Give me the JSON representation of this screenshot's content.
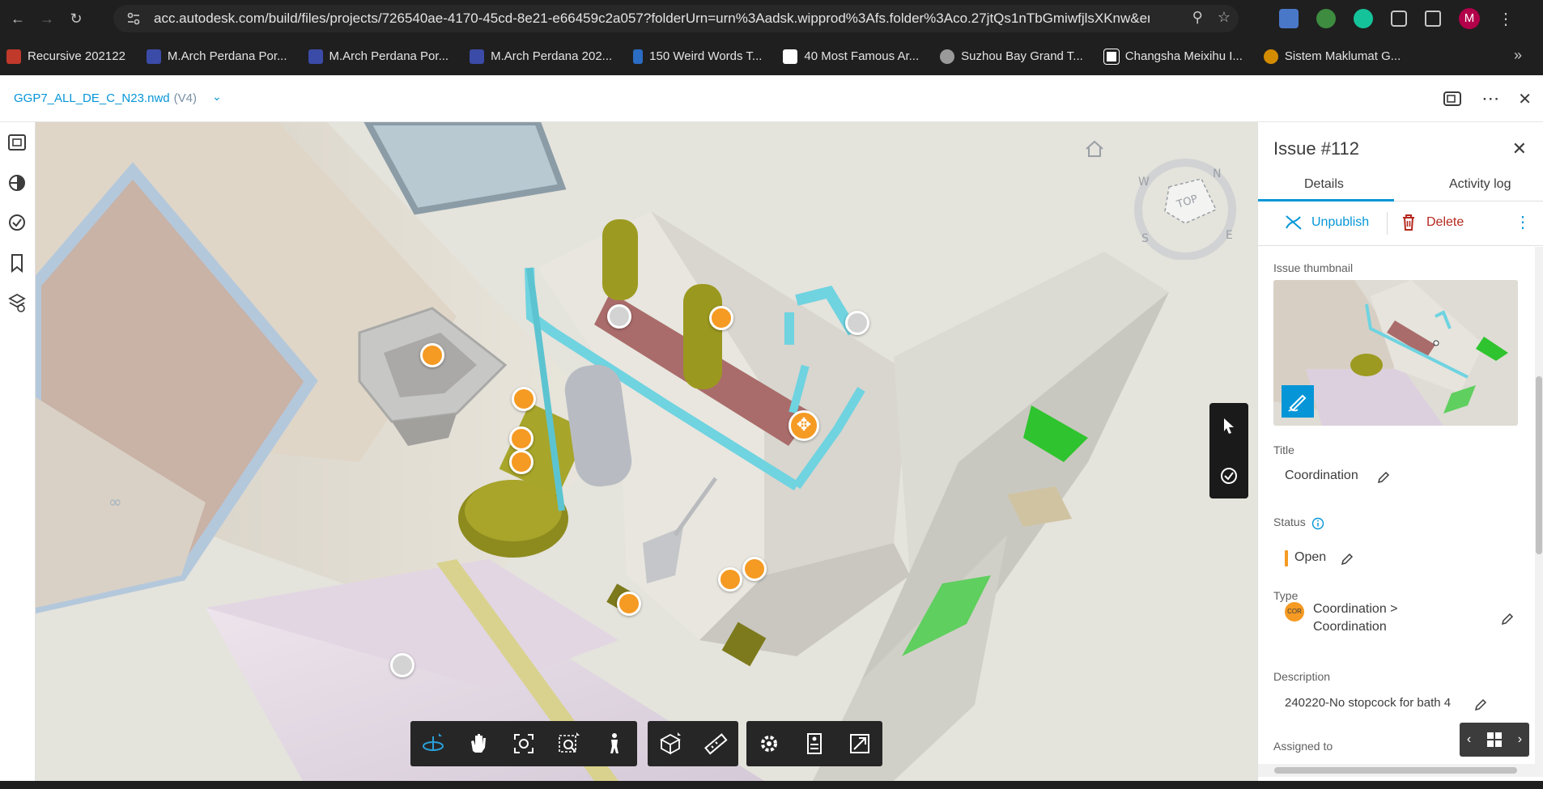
{
  "browser": {
    "url": "acc.autodesk.com/build/files/projects/726540ae-4170-45cd-8e21-e66459c2a057?folderUrn=urn%3Aadsk.wipprod%3Afs.folder%3Aco.27jtQs1nTbGmiwfjlsXKnw&ent...",
    "profile_initial": "M",
    "bookmarks": [
      "Recursive 202122",
      "M.Arch Perdana Por...",
      "M.Arch Perdana Por...",
      "M.Arch Perdana 202...",
      "150 Weird Words T...",
      "40 Most Famous Ar...",
      "Suzhou Bay Grand T...",
      "Changsha Meixihu I...",
      "Sistem Maklumat G..."
    ]
  },
  "header": {
    "file_name": "GGP7_ALL_DE_C_N23.nwd",
    "version": "(V4)"
  },
  "viewcube": {
    "face_label": "TOP",
    "compass": {
      "n": "N",
      "e": "E",
      "s": "S",
      "w": "W"
    }
  },
  "issue_panel": {
    "title": "Issue #112",
    "tabs": [
      "Details",
      "Activity log"
    ],
    "active_tab": "Details",
    "actions": {
      "unpublish": "Unpublish",
      "delete": "Delete"
    },
    "thumbnail_label": "Issue thumbnail",
    "fields": {
      "title_label": "Title",
      "title_value": "Coordination",
      "status_label": "Status",
      "status_value": "Open",
      "type_label": "Type",
      "type_badge": "COR",
      "type_value_line1": "Coordination >",
      "type_value_line2": "Coordination",
      "description_label": "Description",
      "description_value": "240220-No stopcock for bath 4",
      "assigned_label": "Assigned to"
    }
  },
  "colors": {
    "accent": "#0696d7",
    "pin_orange": "#f59a23",
    "delete_red": "#b5281f",
    "status_open": "#f59a23"
  },
  "icons": {
    "left_toolbar": [
      "model-browser-icon",
      "properties-icon",
      "issues-icon",
      "bookmarks-icon",
      "sheets-icon"
    ],
    "nav_tools": [
      "orbit-icon",
      "pan-icon",
      "fit-view-icon",
      "zoom-window-icon",
      "first-person-icon"
    ],
    "model_tools": [
      "section-box-icon",
      "measure-icon"
    ],
    "settings_tools": [
      "settings-icon",
      "properties-panel-icon",
      "fullscreen-icon"
    ]
  }
}
